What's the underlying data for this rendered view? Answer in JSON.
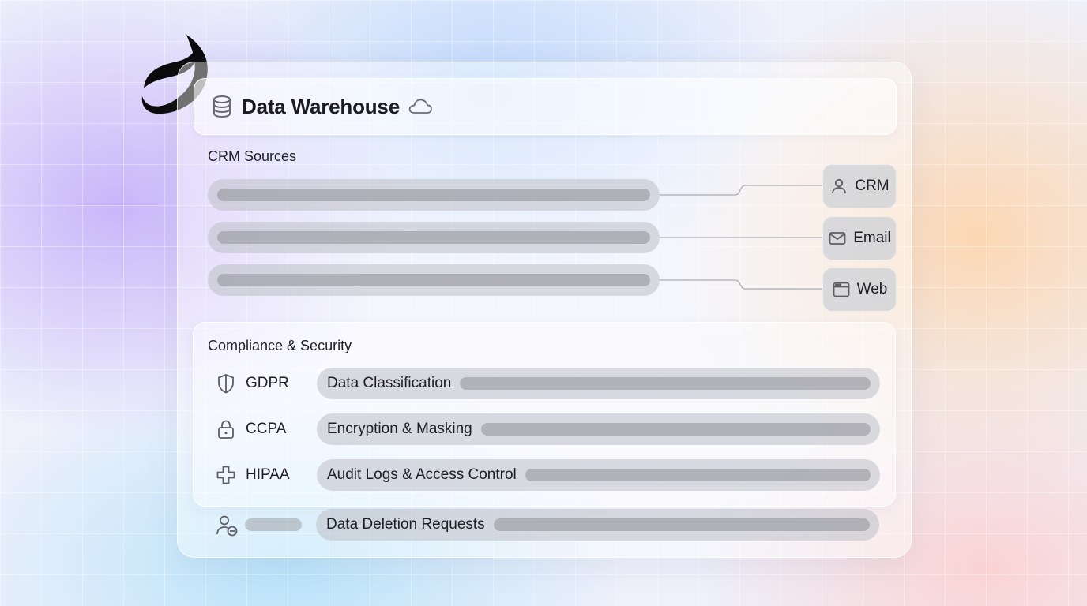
{
  "header": {
    "title": "Data Warehouse",
    "icon": "database-icon",
    "status_icon": "cloud-icon"
  },
  "crm_sources": {
    "title": "CRM Sources",
    "channels": [
      {
        "label": "CRM",
        "icon": "user-icon"
      },
      {
        "label": "Email",
        "icon": "mail-icon"
      },
      {
        "label": "Web",
        "icon": "browser-window-icon"
      }
    ]
  },
  "compliance": {
    "title": "Compliance & Security",
    "rows": [
      {
        "label": "GDPR",
        "icon": "shield-icon",
        "control": "Data Classification"
      },
      {
        "label": "CCPA",
        "icon": "lock-icon",
        "control": "Encryption & Masking"
      },
      {
        "label": "HIPAA",
        "icon": "medical-cross-icon",
        "control": "Audit Logs & Access Control"
      }
    ]
  },
  "deletion_row": {
    "icon": "user-remove-icon",
    "control": "Data Deletion Requests"
  },
  "colors": {
    "text": "#1e1e24",
    "logo": "#0b0b0d"
  }
}
